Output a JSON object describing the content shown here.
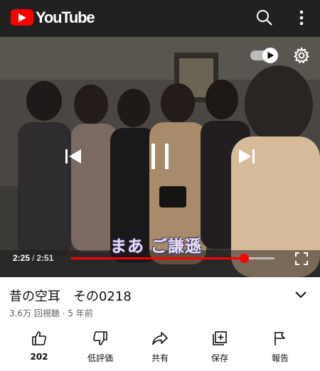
{
  "app": {
    "name": "YouTube"
  },
  "colors": {
    "brand_red": "#ff0000",
    "topbar_bg": "#212121",
    "text": "#0f0f0f",
    "secondary_text": "#606060"
  },
  "header": {
    "icons": [
      "search-icon",
      "more-vert-icon"
    ]
  },
  "player": {
    "caption": "まあ ご謙遜",
    "current_time": "2:25",
    "separator": "/",
    "duration": "2:51",
    "progress_fraction": 0.85,
    "controls": [
      "previous-icon",
      "pause-icon",
      "next-icon",
      "autoplay-toggle",
      "settings-gear-icon",
      "fullscreen-icon"
    ]
  },
  "video": {
    "title": "昔の空耳　その0218",
    "meta": "3.6万 回視聴 · 5 年前"
  },
  "actions": [
    {
      "icon": "like-icon",
      "label": "202"
    },
    {
      "icon": "dislike-icon",
      "label": "低評価"
    },
    {
      "icon": "share-icon",
      "label": "共有"
    },
    {
      "icon": "save-playlist-icon",
      "label": "保存"
    },
    {
      "icon": "report-flag-icon",
      "label": "報告"
    }
  ]
}
